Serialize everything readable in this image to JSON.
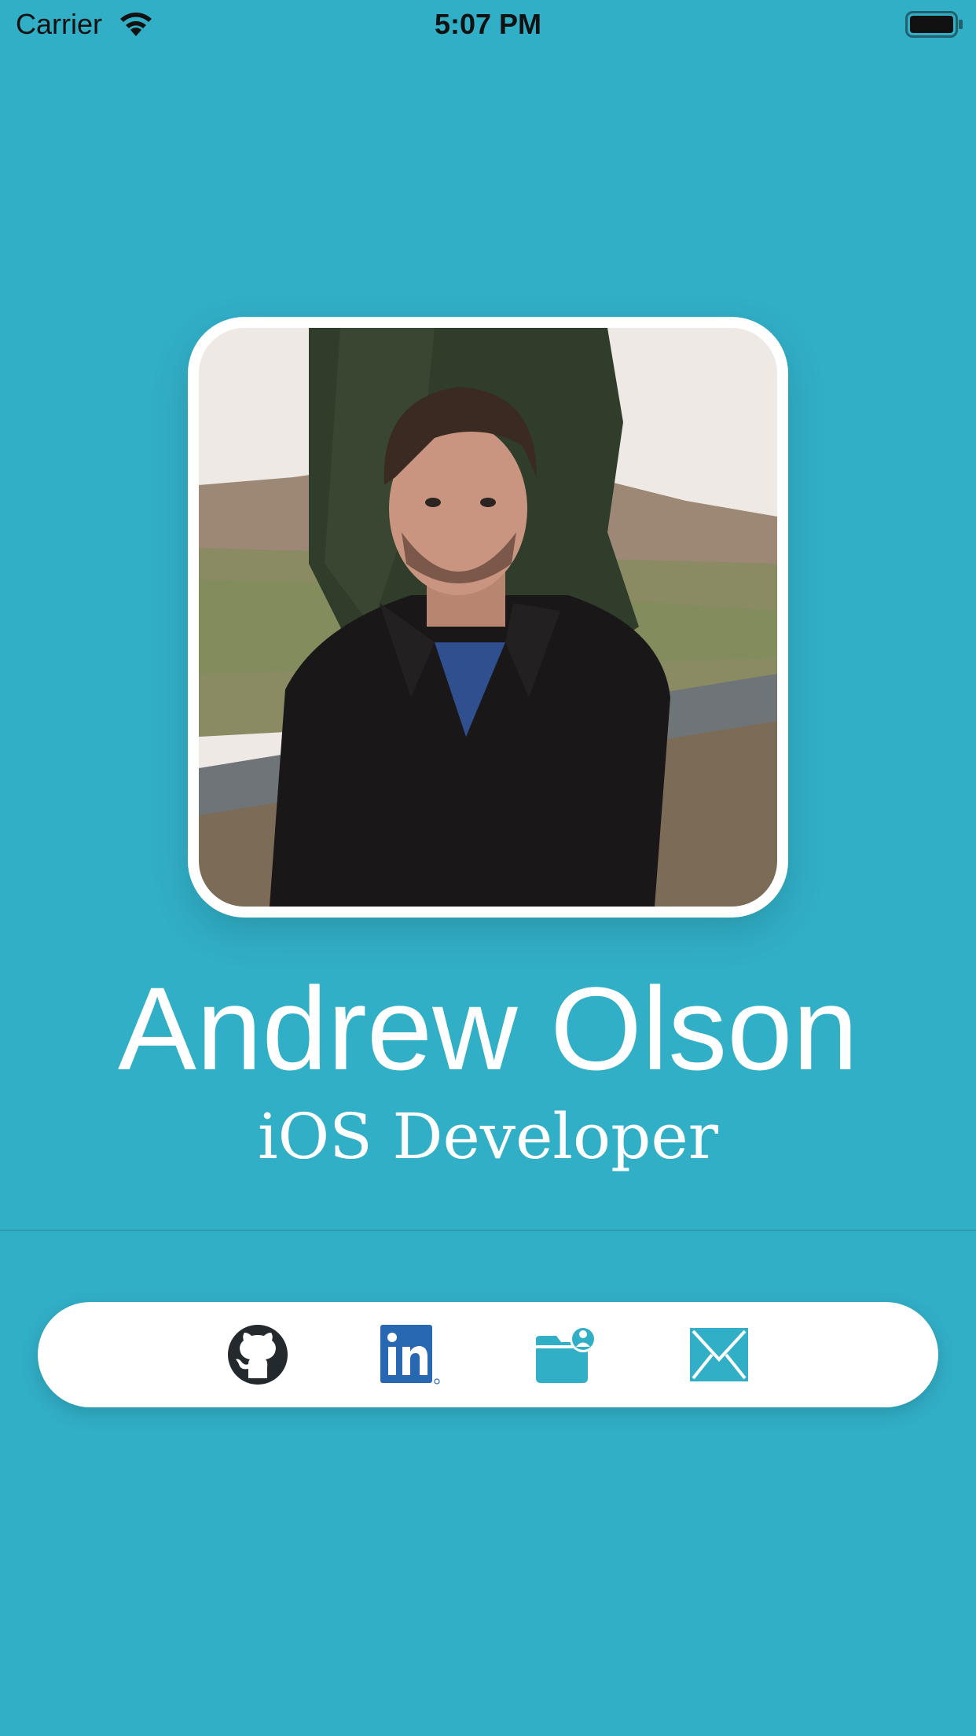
{
  "status_bar": {
    "carrier": "Carrier",
    "time": "5:07 PM"
  },
  "profile": {
    "name": "Andrew Olson",
    "title": "iOS Developer"
  },
  "links": [
    {
      "icon": "github-icon"
    },
    {
      "icon": "linkedin-icon"
    },
    {
      "icon": "portfolio-folder-icon"
    },
    {
      "icon": "mail-icon"
    }
  ],
  "colors": {
    "background": "#31afc7",
    "card": "#ffffff",
    "linkedin": "#2867b2",
    "github": "#24292e"
  }
}
